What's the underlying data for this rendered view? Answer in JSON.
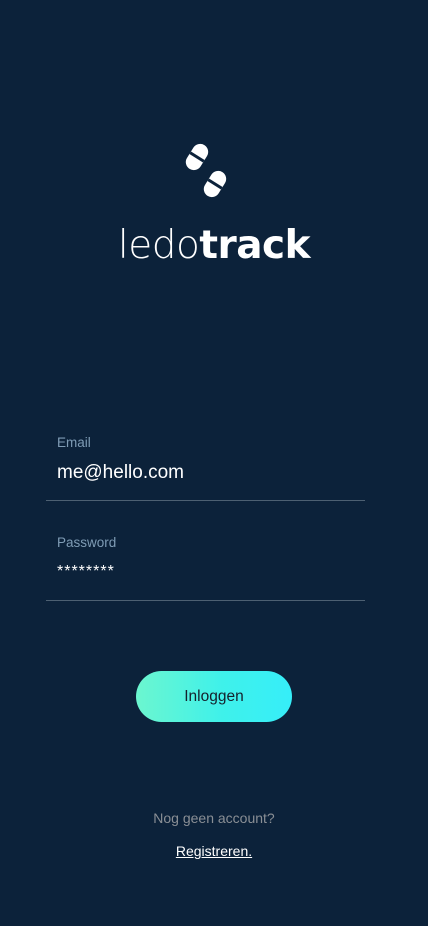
{
  "app": {
    "logo_icon": "pills-icon",
    "wordmark_light": "ledo",
    "wordmark_bold": "track"
  },
  "form": {
    "email": {
      "label": "Email",
      "value": "me@hello.com"
    },
    "password": {
      "label": "Password",
      "value": "********"
    },
    "login_label": "Inloggen"
  },
  "footer": {
    "no_account_text": "Nog geen account?",
    "register_label": "Registreren."
  },
  "colors": {
    "background": "#0c223a",
    "accent_gradient_start": "#6cf6cf",
    "accent_gradient_end": "#36eef9",
    "field_label": "#7f9cb5"
  }
}
